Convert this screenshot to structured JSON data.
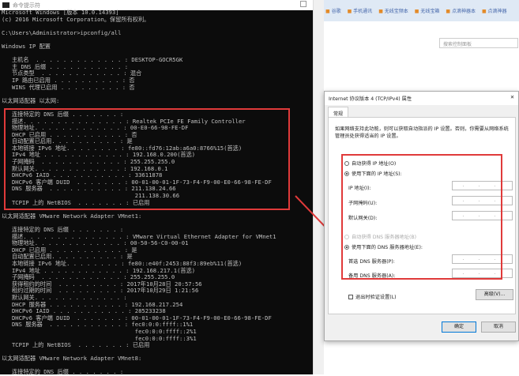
{
  "console": {
    "title": "命令提示符",
    "lines": [
      "Microsoft Windows [版本 10.0.14393]",
      "(c) 2016 Microsoft Corporation。保留所有权利。",
      "",
      "C:\\Users\\Administrator>ipconfig/all",
      "",
      "Windows IP 配置",
      "",
      "   主机名  . . . . . . . . . . . . . : DESKTOP-GOCR5GK",
      "   主 DNS 后缀 . . . . . . . . . . . :",
      "   节点类型  . . . . . . . . . . . . : 混合",
      "   IP 路由已启用 . . . . . . . . . . : 否",
      "   WINS 代理已启用 . . . . . . . . . : 否",
      "",
      "以太网适配器 以太网:",
      "",
      "   连接特定的 DNS 后缀 . . . . . . . :",
      "   描述. . . . . . . . . . . . . . . : Realtek PCIe FE Family Controller",
      "   物理地址. . . . . . . . . . . . . : 00-E0-66-98-FE-DF",
      "   DHCP 已启用 . . . . . . . . . . . : 否",
      "   自动配置已启用. . . . . . . . . . : 是",
      "   本地链接 IPv6 地址. . . . . . . . : fe80::fd76:12ab:a6a0:8766%15(首选)",
      "   IPv4 地址 . . . . . . . . . . . . : 192.168.0.200(首选)",
      "   子网掩码  . . . . . . . . . . . . : 255.255.255.0",
      "   默认网关. . . . . . . . . . . . . : 192.168.0.1",
      "   DHCPv6 IAID . . . . . . . . . . . : 33611878",
      "   DHCPv6 客户端 DUID  . . . . . . . : 00-01-00-01-1F-73-F4-F9-00-E0-66-98-FE-DF",
      "   DNS 服务器  . . . . . . . . . . . : 211.138.24.66",
      "                                       211.138.30.66",
      "   TCPIP 上的 NetBIOS  . . . . . . . : 已启用",
      "",
      "以太网适配器 VMware Network Adapter VMnet1:",
      "",
      "   连接特定的 DNS 后缀 . . . . . . . :",
      "   描述. . . . . . . . . . . . . . . : VMware Virtual Ethernet Adapter for VMnet1",
      "   物理地址. . . . . . . . . . . . . : 00-50-56-C0-00-01",
      "   DHCP 已启用 . . . . . . . . . . . : 是",
      "   自动配置已启用. . . . . . . . . . : 是",
      "   本地链接 IPv6 地址. . . . . . . . : fe80::e40f:2453:88f3:89eb%11(首选)",
      "   IPv4 地址 . . . . . . . . . . . . : 192.168.217.1(首选)",
      "   子网掩码  . . . . . . . . . . . . : 255.255.255.0",
      "   获得租约的时间  . . . . . . . . . : 2017年10月28日 20:57:56",
      "   租约过期的时间  . . . . . . . . . : 2017年10月29日 1:21:56",
      "   默认网关. . . . . . . . . . . . . :",
      "   DHCP 服务器 . . . . . . . . . . . : 192.168.217.254",
      "   DHCPv6 IAID . . . . . . . . . . . : 285233238",
      "   DHCPv6 客户端 DUID  . . . . . . . : 00-01-00-01-1F-73-F4-F9-00-E0-66-98-FE-DF",
      "   DNS 服务器  . . . . . . . . . . . : fec0:0:0:ffff::1%1",
      "                                       fec0:0:0:ffff::2%1",
      "                                       fec0:0:0:ffff::3%1",
      "   TCPIP 上的 NetBIOS  . . . . . . . : 已启用",
      "",
      "以太网适配器 VMware Network Adapter VMnet8:",
      "",
      "   连接特定的 DNS 后缀 . . . . . . . :"
    ]
  },
  "browser": {
    "bookmarks": [
      "谷歌",
      "手机通讯",
      "无线宝频本",
      "无线宝箱",
      "点滴神器本",
      "点滴神器"
    ],
    "search_placeholder": "搜索控制面板"
  },
  "dialog": {
    "title": "Internet 协议版本 4 (TCP/IPv4) 属性",
    "close": "✕",
    "tab": "常规",
    "description": "如果网络支持此功能，则可以获取自动指派的 IP 设置。否则，你需要从网络系统管理员处获得适当的 IP 设置。",
    "auto_ip": "自动获得 IP 地址(O)",
    "manual_ip": "使用下面的 IP 地址(S):",
    "ip_label": "IP 地址(I):",
    "mask_label": "子网掩码(U):",
    "gateway_label": "默认网关(D):",
    "auto_dns": "自动获得 DNS 服务器地址(B)",
    "manual_dns": "使用下面的 DNS 服务器地址(E):",
    "pref_dns_label": "首选 DNS 服务器(P):",
    "alt_dns_label": "备用 DNS 服务器(A):",
    "empty_ip": ". . .",
    "validate": "退出时验证设置(L)",
    "advanced": "高级(V)...",
    "ok": "确定",
    "cancel": "取消"
  }
}
